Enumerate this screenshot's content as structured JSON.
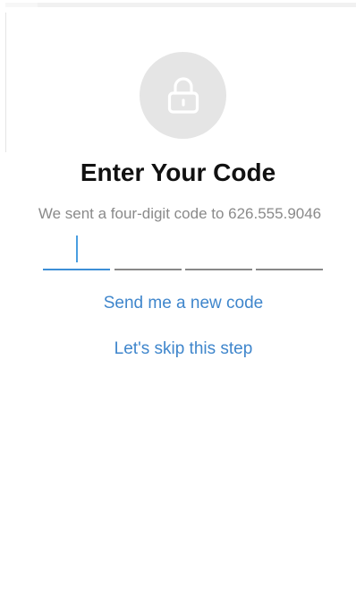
{
  "header": {
    "lock_icon": "lock-icon"
  },
  "content": {
    "title": "Enter Your Code",
    "subtitle": "We sent a four-digit code to 626.555.9046"
  },
  "code_input": {
    "digit_count": 4,
    "digits": [
      "",
      "",
      "",
      ""
    ],
    "active_index": 0
  },
  "links": {
    "resend_label": "Send me a new code",
    "skip_label": "Let's skip this step"
  },
  "colors": {
    "accent": "#3f86cc",
    "active_underline": "#3d8fd6",
    "inactive_underline": "#888888",
    "icon_circle": "#e5e5e5",
    "icon_stroke": "#ffffff",
    "title_text": "#111111",
    "subtitle_text": "#8a8a8a"
  }
}
